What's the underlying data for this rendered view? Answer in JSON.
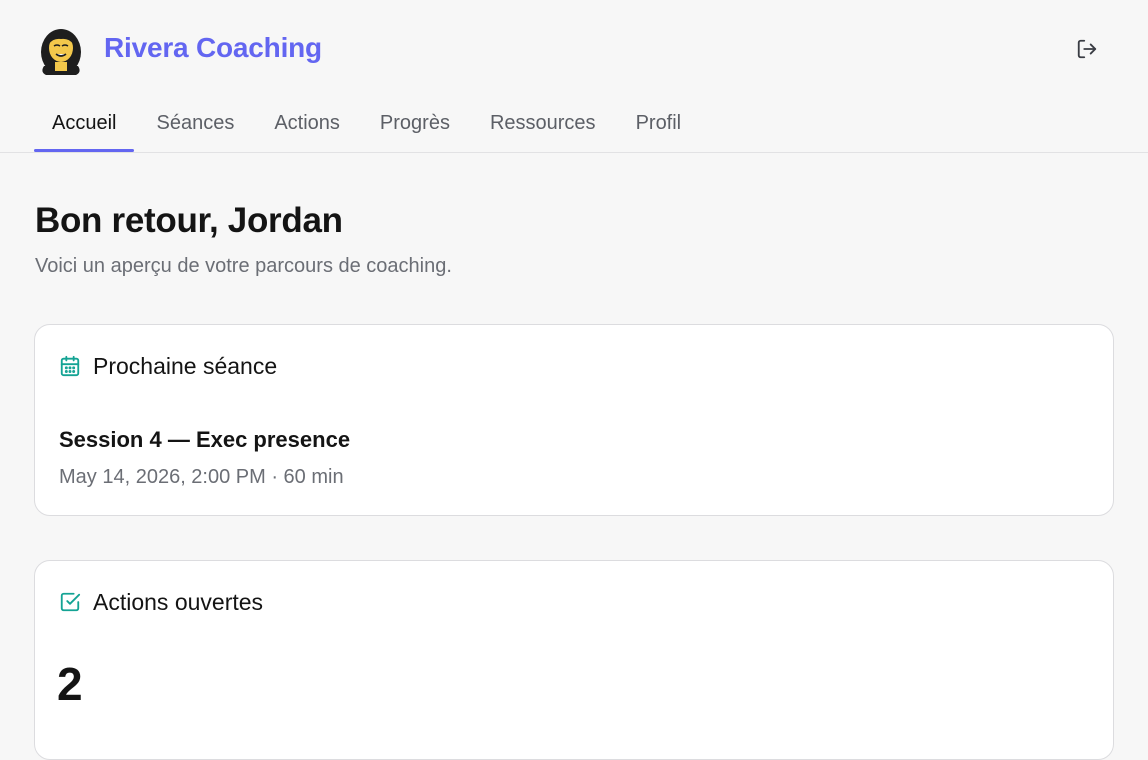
{
  "brand": {
    "name": "Rivera Coaching",
    "accent": "#6366f1"
  },
  "icons": {
    "avatar": "avatar-illustration",
    "logout": "logout-icon",
    "calendar": "calendar-icon",
    "checkbox": "check-square-icon"
  },
  "nav": {
    "tabs": [
      {
        "label": "Accueil",
        "active": true
      },
      {
        "label": "Séances",
        "active": false
      },
      {
        "label": "Actions",
        "active": false
      },
      {
        "label": "Progrès",
        "active": false
      },
      {
        "label": "Ressources",
        "active": false
      },
      {
        "label": "Profil",
        "active": false
      }
    ]
  },
  "main": {
    "greeting": "Bon retour, Jordan",
    "subtitle": "Voici un aperçu de votre parcours de coaching."
  },
  "next_session": {
    "heading": "Prochaine séance",
    "title": "Session 4 — Exec presence",
    "meta": "May 14, 2026, 2:00 PM · 60 min"
  },
  "open_actions": {
    "heading": "Actions ouvertes",
    "count": "2"
  },
  "colors": {
    "icon_teal": "#14a394",
    "text": "#141414",
    "muted": "#6b6e75"
  }
}
